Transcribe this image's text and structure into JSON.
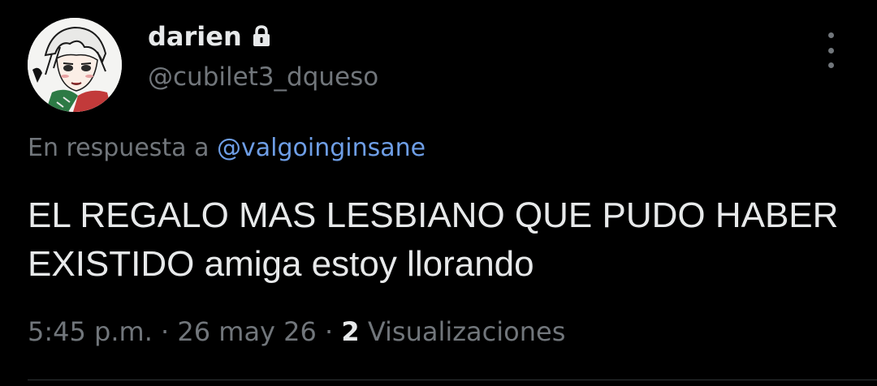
{
  "author": {
    "display_name": "darien",
    "handle": "@cubilet3_dqueso",
    "protected": true
  },
  "reply": {
    "prefix": "En respuesta a ",
    "mention": "@valgoinginsane"
  },
  "tweet": {
    "text": "EL REGALO MAS LESBIANO QUE PUDO HABER EXISTIDO amiga estoy llorando"
  },
  "meta": {
    "time": "5:45 p.m.",
    "separator1": " · ",
    "date": "26 may 26",
    "separator2": " · ",
    "views_count": "2",
    "views_label": " Visualizaciones"
  },
  "colors": {
    "background": "#000000",
    "primary_text": "#e7e9ea",
    "secondary_text": "#71767b",
    "mention": "#6e9ee6",
    "divider": "#2f3336"
  },
  "icons": {
    "lock": "lock-icon",
    "more": "more-options-icon"
  }
}
